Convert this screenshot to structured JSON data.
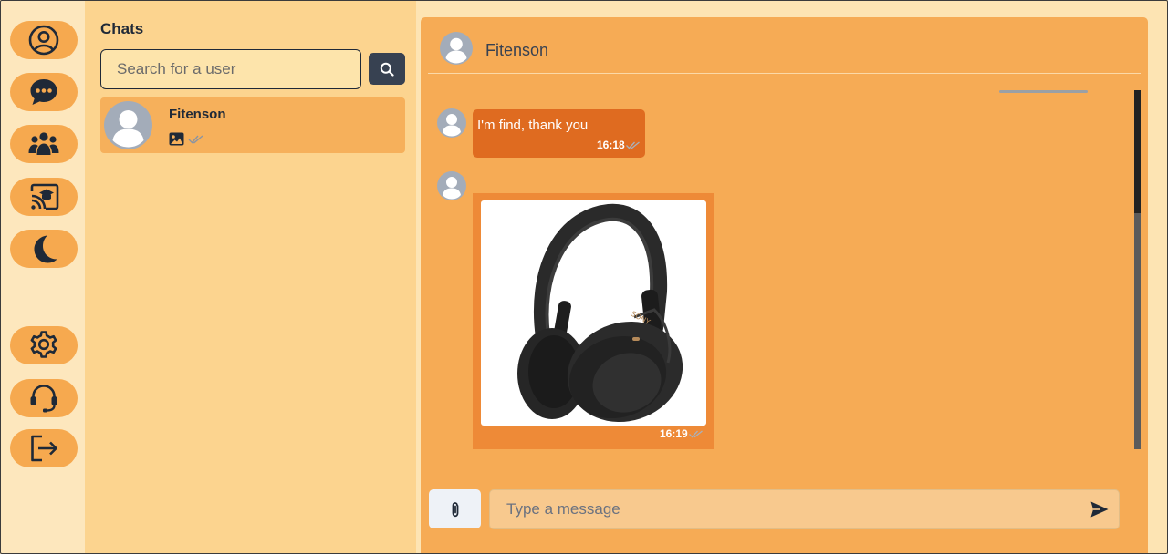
{
  "colors": {
    "rail_bg": "#fde7bd",
    "rail_button": "#f6a94f",
    "chatlist_bg": "#fcd48f",
    "convo_bg": "#f6ab55",
    "bubble_text": "#df6b20",
    "bubble_image": "#ee8a37",
    "dark": "#1f2937"
  },
  "rail": {
    "top_items": [
      {
        "icon": "user-circle-icon"
      },
      {
        "icon": "chat-dots-icon"
      },
      {
        "icon": "people-group-icon"
      },
      {
        "icon": "cast-education-icon"
      },
      {
        "icon": "moon-icon"
      }
    ],
    "bottom_items": [
      {
        "icon": "gear-icon"
      },
      {
        "icon": "headset-icon"
      },
      {
        "icon": "logout-icon"
      }
    ]
  },
  "chatlist": {
    "title": "Chats",
    "search_placeholder": "Search for a user",
    "search_button_icon": "search-icon",
    "items": [
      {
        "name": "Fitenson",
        "preview_icon": "image-icon",
        "status_icon": "double-check-icon"
      }
    ]
  },
  "conversation": {
    "contact_name": "Fitenson",
    "messages": [
      {
        "type": "text",
        "text": "I'm find, thank you",
        "time": "16:18",
        "status_icon": "double-check-icon"
      },
      {
        "type": "image",
        "image": "headphones-photo",
        "time": "16:19",
        "status_icon": "double-check-icon"
      }
    ],
    "composer": {
      "placeholder": "Type a message",
      "attach_icon": "paperclip-icon",
      "send_icon": "send-icon"
    }
  }
}
